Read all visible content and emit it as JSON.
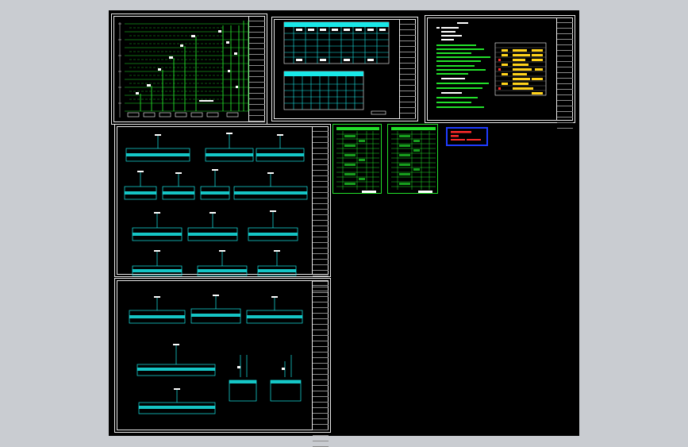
{
  "app": {
    "name": ""
  },
  "colors": {
    "background": "#c9ccd1",
    "canvas": "#000000",
    "frame": "#e8e8e8",
    "green": "#22e02a",
    "cyan": "#19e8e8",
    "yellow": "#ffd21a",
    "red": "#ff2a2a",
    "blue": "#1f3cff"
  },
  "sheets": [
    {
      "id": "riser",
      "kind": "riser-diagram"
    },
    {
      "id": "panel-table",
      "kind": "table"
    },
    {
      "id": "notes",
      "kind": "notes-and-legend"
    },
    {
      "id": "distribution-1",
      "kind": "distribution-boxes"
    },
    {
      "id": "distribution-2",
      "kind": "distribution-boxes"
    },
    {
      "id": "list-1",
      "kind": "material-list"
    },
    {
      "id": "list-2",
      "kind": "material-list"
    }
  ],
  "stamp": {
    "icon": "revision-stamp-icon"
  }
}
